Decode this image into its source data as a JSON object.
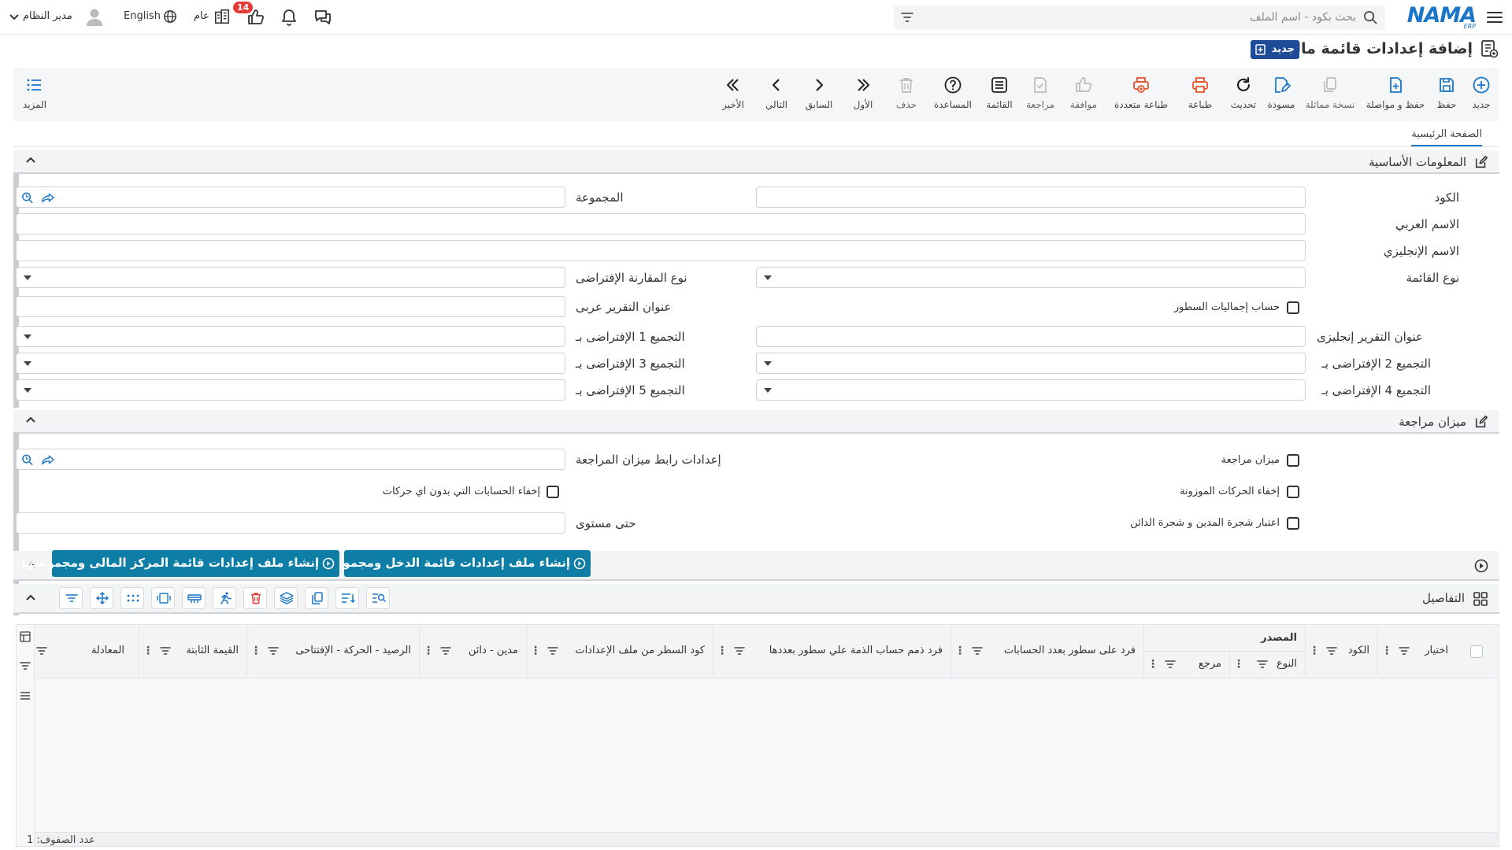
{
  "topbar": {
    "logo_text": "NAMA",
    "logo_sub": "ERP",
    "search_placeholder": "بحث بكود - اسم الملف",
    "notifications_count": "14",
    "general_label": "عام",
    "language_label": "English",
    "user_label": "مدير النظام",
    "icons": [
      "menu-icon",
      "search-icon",
      "filter-icon",
      "chat-icon",
      "bell-icon",
      "thumbs-up-icon",
      "building-icon",
      "globe-icon",
      "user-avatar-icon",
      "chevron-down-icon"
    ]
  },
  "page": {
    "title": "إضافة إعدادات قائمة مالية",
    "new_badge": "جديد"
  },
  "toolbar": {
    "new": "جديد",
    "save": "حفظ",
    "save_continue": "حفظ و مواصلة",
    "duplicate": "نسخة مماثلة",
    "draft": "مسودة",
    "refresh": "تحديث",
    "print": "طباعة",
    "multi_print": "طباعة متعددة",
    "approve": "موافقة",
    "review": "مراجعة",
    "list": "القائمة",
    "help": "المساعدة",
    "delete": "حذف",
    "first": "الأول",
    "previous": "السابق",
    "next": "التالي",
    "last": "الأخير",
    "more": "المزيد"
  },
  "tabs": {
    "home": "الصفحة الرئيسية"
  },
  "basic_info": {
    "title": "المعلومات الأساسية",
    "code_label": "الكود",
    "group_label": "المجموعة",
    "arabic_name_label": "الاسم العربي",
    "english_name_label": "الاسم الإنجليزي",
    "list_type_label": "نوع القائمة",
    "default_comparison_label": "نوع المقارنة الإفتراضى",
    "line_totals_label": "حساب إجماليات السطور",
    "report_title_ar_label": "عنوان التقرير عربى",
    "report_title_en_label": "عنوان التقرير إنجليزى",
    "default_group1_label": "التجميع 1 الإفتراضى بـ",
    "default_group2_label": "التجميع 2 الإفتراضى بـ",
    "default_group3_label": "التجميع 3 الإفتراضى بـ",
    "default_group4_label": "التجميع 4 الإفتراضى بـ",
    "default_group5_label": "التجميع 5 الإفتراضى بـ"
  },
  "trial_balance": {
    "title": "ميزان مراجعة",
    "trial_balance_label": "ميزان مراجعة",
    "link_settings_label": "إعدادات رابط ميزان المراجعة",
    "hide_balanced_label": "إخفاء الحركات الموزونة",
    "hide_no_movement_label": "إخفاء الحسابات التي بدون اي حركات",
    "debtor_creditor_tree_label": "اعتبار شجرة المدين و شجرة الدائن",
    "up_to_level_label": "حتى مستوى"
  },
  "actions": {
    "create_income": "إنشاء ملف إعدادات قائمة الدخل ومجموعتها",
    "create_financial_position": "إنشاء ملف إعدادات قائمة المركز المالى ومجموعتها"
  },
  "details": {
    "title": "التفاصيل",
    "columns": {
      "select": "اختيار",
      "code": "الكود",
      "source": "المصدر",
      "type": "النوع",
      "reference": "مرجع",
      "spread_by_accounts": "فرد على سطور بعدد الحسابات",
      "spread_debit_by_lines": "فرد ذمم حساب الذمة علي سطور بعددها",
      "line_code_from_settings": "كود السطر من ملف الإعدادات",
      "debit_credit": "مدين - دائن",
      "balance_movement_opening": "الرصيد - الحركة - الإفتتاحى",
      "fixed_value": "القيمة الثابتة",
      "equation": "المعادلة"
    },
    "row_count_label": "عدد الصفوف",
    "row_count": "1"
  }
}
